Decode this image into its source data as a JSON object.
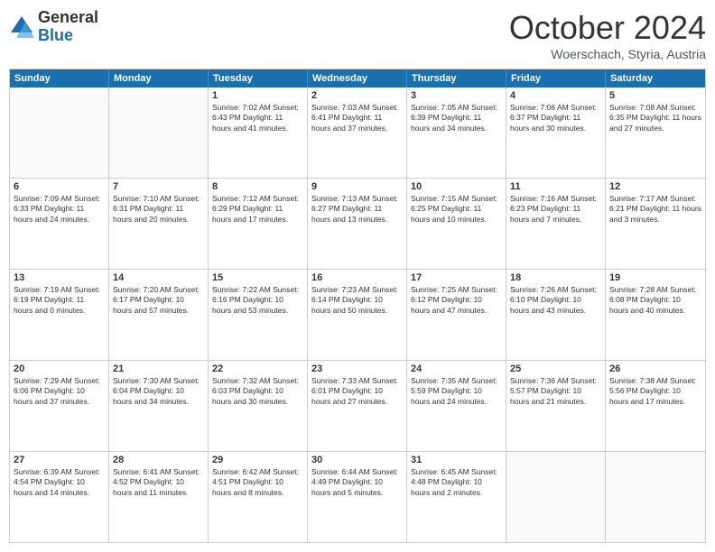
{
  "logo": {
    "line1": "General",
    "line2": "Blue"
  },
  "header": {
    "month": "October 2024",
    "location": "Woerschach, Styria, Austria"
  },
  "weekdays": [
    "Sunday",
    "Monday",
    "Tuesday",
    "Wednesday",
    "Thursday",
    "Friday",
    "Saturday"
  ],
  "rows": [
    [
      {
        "day": "",
        "info": ""
      },
      {
        "day": "",
        "info": ""
      },
      {
        "day": "1",
        "info": "Sunrise: 7:02 AM\nSunset: 6:43 PM\nDaylight: 11 hours and 41 minutes."
      },
      {
        "day": "2",
        "info": "Sunrise: 7:03 AM\nSunset: 6:41 PM\nDaylight: 11 hours and 37 minutes."
      },
      {
        "day": "3",
        "info": "Sunrise: 7:05 AM\nSunset: 6:39 PM\nDaylight: 11 hours and 34 minutes."
      },
      {
        "day": "4",
        "info": "Sunrise: 7:06 AM\nSunset: 6:37 PM\nDaylight: 11 hours and 30 minutes."
      },
      {
        "day": "5",
        "info": "Sunrise: 7:08 AM\nSunset: 6:35 PM\nDaylight: 11 hours and 27 minutes."
      }
    ],
    [
      {
        "day": "6",
        "info": "Sunrise: 7:09 AM\nSunset: 6:33 PM\nDaylight: 11 hours and 24 minutes."
      },
      {
        "day": "7",
        "info": "Sunrise: 7:10 AM\nSunset: 6:31 PM\nDaylight: 11 hours and 20 minutes."
      },
      {
        "day": "8",
        "info": "Sunrise: 7:12 AM\nSunset: 6:29 PM\nDaylight: 11 hours and 17 minutes."
      },
      {
        "day": "9",
        "info": "Sunrise: 7:13 AM\nSunset: 6:27 PM\nDaylight: 11 hours and 13 minutes."
      },
      {
        "day": "10",
        "info": "Sunrise: 7:15 AM\nSunset: 6:25 PM\nDaylight: 11 hours and 10 minutes."
      },
      {
        "day": "11",
        "info": "Sunrise: 7:16 AM\nSunset: 6:23 PM\nDaylight: 11 hours and 7 minutes."
      },
      {
        "day": "12",
        "info": "Sunrise: 7:17 AM\nSunset: 6:21 PM\nDaylight: 11 hours and 3 minutes."
      }
    ],
    [
      {
        "day": "13",
        "info": "Sunrise: 7:19 AM\nSunset: 6:19 PM\nDaylight: 11 hours and 0 minutes."
      },
      {
        "day": "14",
        "info": "Sunrise: 7:20 AM\nSunset: 6:17 PM\nDaylight: 10 hours and 57 minutes."
      },
      {
        "day": "15",
        "info": "Sunrise: 7:22 AM\nSunset: 6:16 PM\nDaylight: 10 hours and 53 minutes."
      },
      {
        "day": "16",
        "info": "Sunrise: 7:23 AM\nSunset: 6:14 PM\nDaylight: 10 hours and 50 minutes."
      },
      {
        "day": "17",
        "info": "Sunrise: 7:25 AM\nSunset: 6:12 PM\nDaylight: 10 hours and 47 minutes."
      },
      {
        "day": "18",
        "info": "Sunrise: 7:26 AM\nSunset: 6:10 PM\nDaylight: 10 hours and 43 minutes."
      },
      {
        "day": "19",
        "info": "Sunrise: 7:28 AM\nSunset: 6:08 PM\nDaylight: 10 hours and 40 minutes."
      }
    ],
    [
      {
        "day": "20",
        "info": "Sunrise: 7:29 AM\nSunset: 6:06 PM\nDaylight: 10 hours and 37 minutes."
      },
      {
        "day": "21",
        "info": "Sunrise: 7:30 AM\nSunset: 6:04 PM\nDaylight: 10 hours and 34 minutes."
      },
      {
        "day": "22",
        "info": "Sunrise: 7:32 AM\nSunset: 6:03 PM\nDaylight: 10 hours and 30 minutes."
      },
      {
        "day": "23",
        "info": "Sunrise: 7:33 AM\nSunset: 6:01 PM\nDaylight: 10 hours and 27 minutes."
      },
      {
        "day": "24",
        "info": "Sunrise: 7:35 AM\nSunset: 5:59 PM\nDaylight: 10 hours and 24 minutes."
      },
      {
        "day": "25",
        "info": "Sunrise: 7:36 AM\nSunset: 5:57 PM\nDaylight: 10 hours and 21 minutes."
      },
      {
        "day": "26",
        "info": "Sunrise: 7:38 AM\nSunset: 5:56 PM\nDaylight: 10 hours and 17 minutes."
      }
    ],
    [
      {
        "day": "27",
        "info": "Sunrise: 6:39 AM\nSunset: 4:54 PM\nDaylight: 10 hours and 14 minutes."
      },
      {
        "day": "28",
        "info": "Sunrise: 6:41 AM\nSunset: 4:52 PM\nDaylight: 10 hours and 11 minutes."
      },
      {
        "day": "29",
        "info": "Sunrise: 6:42 AM\nSunset: 4:51 PM\nDaylight: 10 hours and 8 minutes."
      },
      {
        "day": "30",
        "info": "Sunrise: 6:44 AM\nSunset: 4:49 PM\nDaylight: 10 hours and 5 minutes."
      },
      {
        "day": "31",
        "info": "Sunrise: 6:45 AM\nSunset: 4:48 PM\nDaylight: 10 hours and 2 minutes."
      },
      {
        "day": "",
        "info": ""
      },
      {
        "day": "",
        "info": ""
      }
    ]
  ]
}
